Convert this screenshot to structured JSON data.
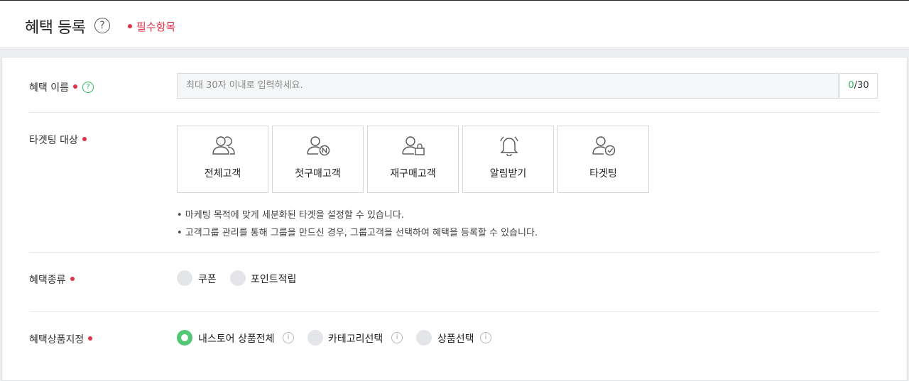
{
  "header": {
    "title": "혜택 등록",
    "help_glyph": "?",
    "required_legend": "필수항목"
  },
  "form": {
    "benefit_name": {
      "label": "혜택 이름",
      "help_glyph": "?",
      "placeholder": "최대 30자 이내로 입력하세요.",
      "count_current": "0",
      "count_max": "/30"
    },
    "targeting": {
      "label": "타겟팅 대상",
      "options": [
        {
          "label": "전체고객",
          "icon": "users-group-icon"
        },
        {
          "label": "첫구매고객",
          "icon": "user-new-icon"
        },
        {
          "label": "재구매고객",
          "icon": "user-bag-icon"
        },
        {
          "label": "알림받기",
          "icon": "bell-icon"
        },
        {
          "label": "타겟팅",
          "icon": "user-check-icon"
        }
      ],
      "notes": [
        "• 마케팅 목적에 맞게 세분화된 타겟을 설정할 수 있습니다.",
        "• 고객그룹 관리를 통해 그룹을 만드신 경우, 그룹고객을 선택하여 혜택을 등록할 수 있습니다."
      ]
    },
    "benefit_type": {
      "label": "혜택종류",
      "options": [
        "쿠폰",
        "포인트적립"
      ]
    },
    "product_scope": {
      "label": "혜택상품지정",
      "info_glyph": "i",
      "options": [
        "내스토어 상품전체",
        "카테고리선택",
        "상품선택"
      ],
      "selected": "내스토어 상품전체"
    }
  },
  "colors": {
    "required": "#e0324a",
    "accent_green": "#2fb65c",
    "radio_on": "#52c775"
  }
}
